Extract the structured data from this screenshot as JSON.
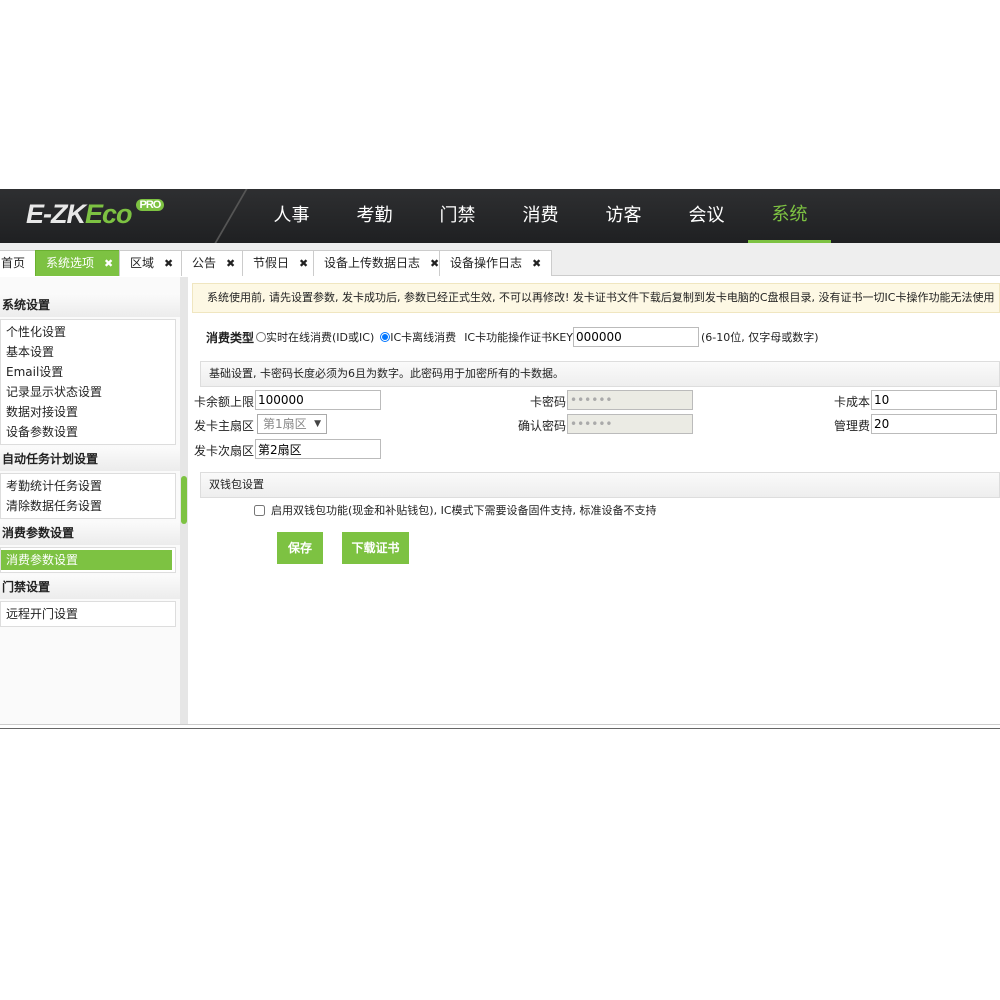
{
  "header": {
    "logo": {
      "main": "E-ZK",
      "accent": "Eco",
      "badge": "PRO"
    },
    "nav": [
      "人事",
      "考勤",
      "门禁",
      "消费",
      "访客",
      "会议",
      "系统"
    ],
    "active_nav": "系统"
  },
  "tabs": [
    {
      "label": "首页"
    },
    {
      "label": "系统选项",
      "active": true
    },
    {
      "label": "区域"
    },
    {
      "label": "公告"
    },
    {
      "label": "节假日"
    },
    {
      "label": "设备上传数据日志"
    },
    {
      "label": "设备操作日志"
    }
  ],
  "close_glyph": "✖",
  "sidebar": {
    "groups": [
      {
        "title": "系统设置",
        "items": [
          "个性化设置",
          "基本设置",
          "Email设置",
          "记录显示状态设置",
          "数据对接设置",
          "设备参数设置"
        ]
      },
      {
        "title": "自动任务计划设置",
        "items": [
          "考勤统计任务设置",
          "清除数据任务设置"
        ]
      },
      {
        "title": "消费参数设置",
        "items": [
          "消费参数设置"
        ]
      },
      {
        "title": "门禁设置",
        "items": [
          "远程开门设置"
        ]
      }
    ],
    "active_item": "消费参数设置"
  },
  "main": {
    "notice": "系统使用前, 请先设置参数, 发卡成功后, 参数已经正式生效, 不可以再修改! 发卡证书文件下载后复制到发卡电脑的C盘根目录, 没有证书一切IC卡操作功能无法使用",
    "consume_type_label": "消费类型",
    "radio_online": "实时在线消费(ID或IC)",
    "radio_offline": "IC卡离线消费",
    "selected_radio": "IC卡离线消费",
    "key_label": "IC卡功能操作证书KEY",
    "key_value": "000000",
    "key_hint": "(6-10位, 仅字母或数字)",
    "basic_bar": "基础设置, 卡密码长度必须为6且为数字。此密码用于加密所有的卡数据。",
    "fields": {
      "balance_limit_label": "卡余额上限",
      "balance_limit": "100000",
      "card_password_label": "卡密码",
      "card_password": "••••••",
      "card_cost_label": "卡成本",
      "card_cost": "10",
      "main_sector_label": "发卡主扇区",
      "main_sector": "第1扇区",
      "confirm_password_label": "确认密码",
      "confirm_password": "••••••",
      "mgmt_fee_label": "管理费",
      "mgmt_fee": "20",
      "sub_sector_label": "发卡次扇区",
      "sub_sector": "第2扇区"
    },
    "wallet_bar": "双钱包设置",
    "wallet_checkbox": "启用双钱包功能(现金和补贴钱包), IC模式下需要设备固件支持, 标准设备不支持",
    "wallet_checked": false,
    "save_label": "保存",
    "download_label": "下载证书"
  },
  "colors": {
    "accent": "#7dc242",
    "header_bg": "#2a2b2d"
  }
}
